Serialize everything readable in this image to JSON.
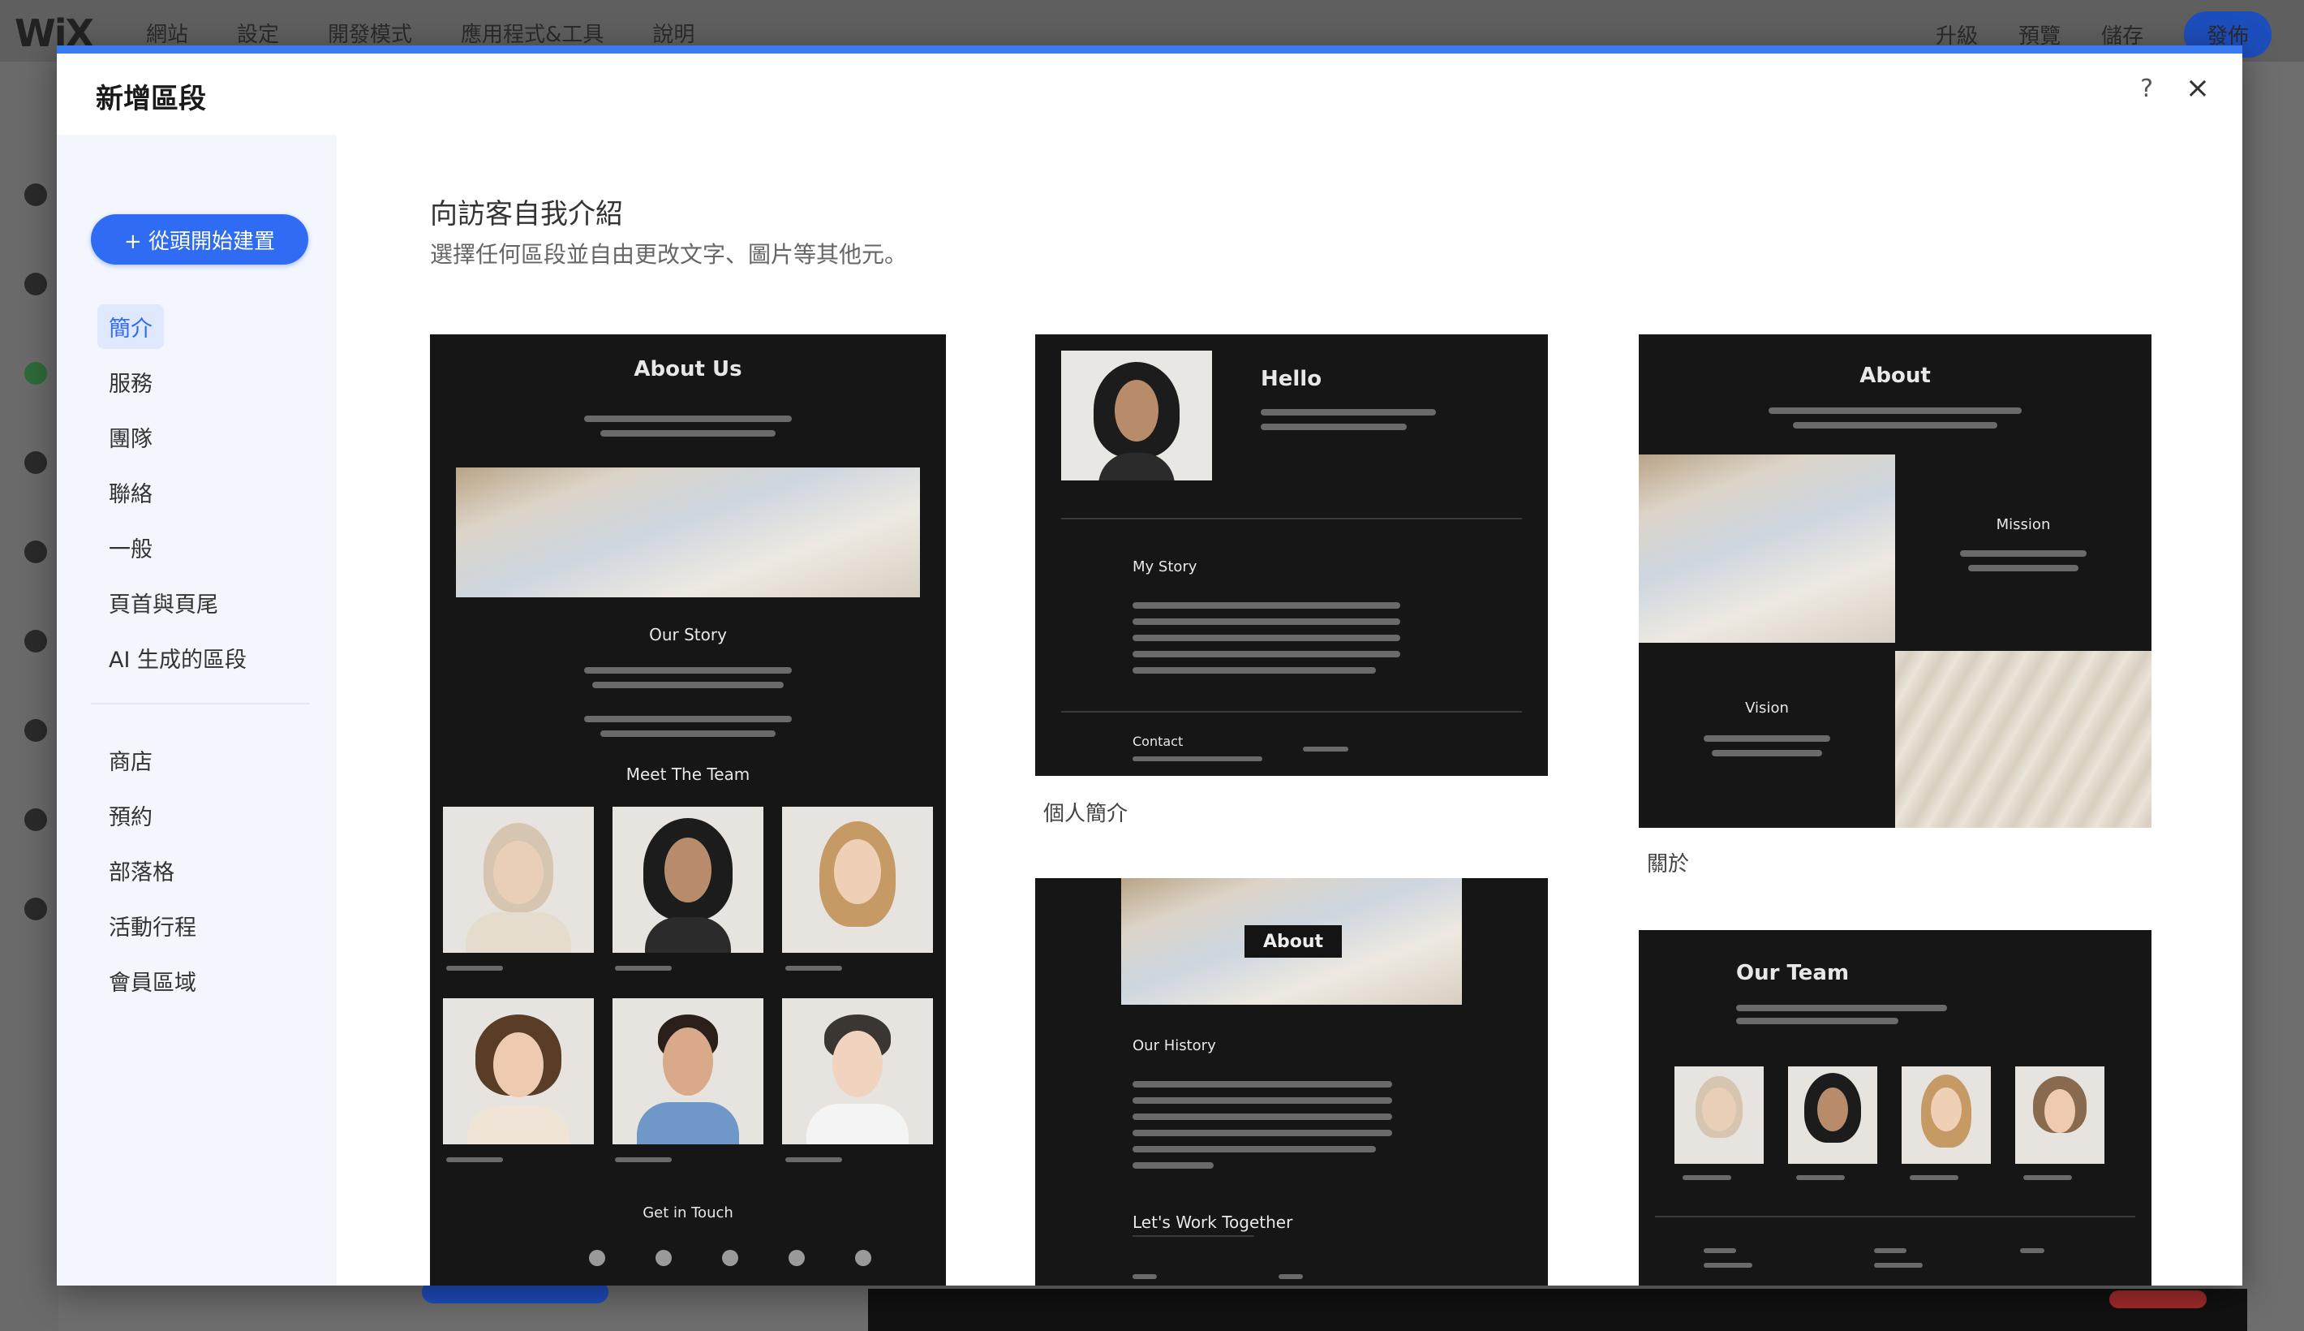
{
  "editor": {
    "logo": "WiX",
    "menu": [
      "網站",
      "設定",
      "開發模式",
      "應用程式&工具",
      "說明"
    ],
    "right": [
      "升級",
      "預覽",
      "儲存"
    ],
    "publish": "發佈"
  },
  "modal": {
    "title": "新增區段",
    "help_icon": "?",
    "close_icon": "×",
    "add_button": "+ 從頭開始建置",
    "nav_primary": [
      {
        "label": "簡介",
        "active": true
      },
      {
        "label": "服務",
        "active": false
      },
      {
        "label": "團隊",
        "active": false
      },
      {
        "label": "聯絡",
        "active": false
      },
      {
        "label": "一般",
        "active": false
      },
      {
        "label": "頁首與頁尾",
        "active": false
      },
      {
        "label": "AI 生成的區段",
        "active": false
      }
    ],
    "nav_secondary": [
      "商店",
      "預約",
      "部落格",
      "活動行程",
      "會員區域"
    ],
    "heading": "向訪客自我介紹",
    "subheading": "選擇任何區段並自由更改文字、圖片等其他元。"
  },
  "cards": {
    "about": {
      "title": "About Us",
      "our_story": "Our Story",
      "meet_team": "Meet The Team",
      "get_in_touch": "Get in Touch"
    },
    "hello": {
      "title": "Hello",
      "my_story": "My Story",
      "contact": "Contact",
      "caption": "個人簡介"
    },
    "about_grid": {
      "title": "About",
      "mission": "Mission",
      "vision": "Vision",
      "caption": "關於"
    },
    "history": {
      "badge": "About",
      "heading": "Our History",
      "together": "Let's Work Together"
    },
    "team": {
      "title": "Our Team"
    }
  }
}
